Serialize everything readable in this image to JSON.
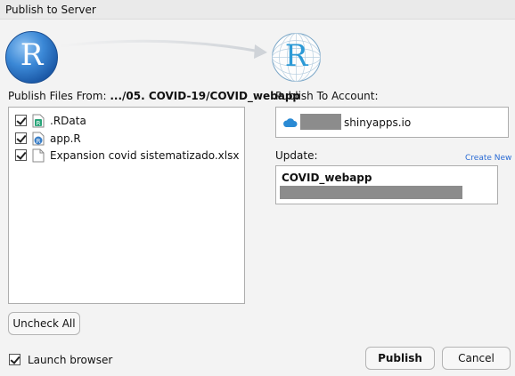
{
  "window": {
    "title": "Publish to Server"
  },
  "logos": {
    "source_letter": "R",
    "target_letter": "R"
  },
  "publish_files": {
    "label_prefix": "Publish Files From: ",
    "path": ".../05. COVID-19/COVID_webapp",
    "files": [
      {
        "name": ".RData",
        "checked": true,
        "icon": "rdata-file-icon"
      },
      {
        "name": "app.R",
        "checked": true,
        "icon": "r-script-icon"
      },
      {
        "name": "Expansion covid sistematizado.xlsx",
        "checked": true,
        "icon": "blank-file-icon"
      }
    ],
    "uncheck_all_label": "Uncheck All"
  },
  "launch_browser": {
    "label": "Launch browser",
    "checked": true
  },
  "account": {
    "label": "Publish To Account:",
    "server": "shinyapps.io",
    "icon": "cloud-icon",
    "color": "#2a8ad4"
  },
  "update": {
    "label": "Update:",
    "create_new_label": "Create New",
    "app_name": "COVID_webapp"
  },
  "buttons": {
    "publish_label": "Publish",
    "cancel_label": "Cancel"
  }
}
